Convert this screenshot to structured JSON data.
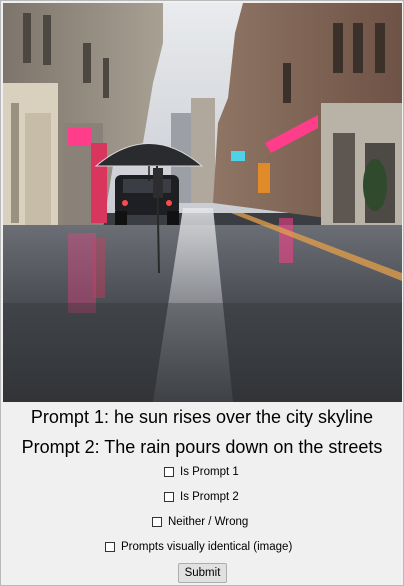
{
  "image": {
    "subject": "rainy-city-street-photo",
    "icon": "photo-image"
  },
  "prompts": {
    "prompt1": "Prompt 1: he sun rises over the city skyline",
    "prompt2": "Prompt 2: The rain pours down on the streets"
  },
  "options": [
    {
      "label": "Is Prompt 1",
      "checked": false
    },
    {
      "label": "Is Prompt 2",
      "checked": false
    },
    {
      "label": "Neither / Wrong",
      "checked": false
    },
    {
      "label": "Prompts visually identical (image)",
      "checked": false
    }
  ],
  "submit_label": "Submit",
  "colors": {
    "background": "#f0f0f0",
    "neon_pink": "#ff3d8a",
    "street_wet": "#4a4d52"
  }
}
